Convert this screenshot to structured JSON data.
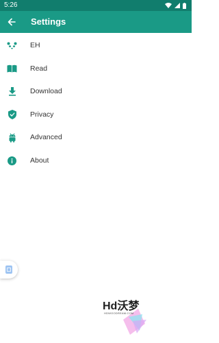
{
  "status_bar": {
    "time": "5:26"
  },
  "app_bar": {
    "title": "Settings"
  },
  "settings": {
    "items": [
      {
        "label": "EH",
        "icon": "panda-icon"
      },
      {
        "label": "Read",
        "icon": "book-icon"
      },
      {
        "label": "Download",
        "icon": "download-icon"
      },
      {
        "label": "Privacy",
        "icon": "shield-icon"
      },
      {
        "label": "Advanced",
        "icon": "android-icon"
      },
      {
        "label": "About",
        "icon": "info-icon"
      }
    ]
  },
  "watermark": {
    "text": "Hd沃梦",
    "subtext": "HDWOODREAM.COM"
  },
  "colors": {
    "status_bar": "#117d6d",
    "app_bar": "#1a9a86",
    "icon_accent": "#1a9a86",
    "text": "#333333"
  }
}
